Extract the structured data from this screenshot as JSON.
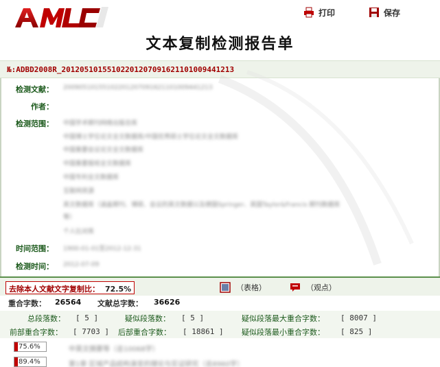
{
  "toolbar": {
    "print_label": "打印",
    "save_label": "保存"
  },
  "logo_text": "AMLC",
  "report_title": "文本复制检测报告单",
  "report_id": "№:ADBD2008R_2012051015510220120709162110100944​1213",
  "fields": {
    "document_label": "检测文献：",
    "document_value": "20090510155102201207091621101009441213",
    "author_label": "作者：",
    "scope_label": "检测范围：",
    "scope_lines": [
      "中国学术期刊网络出版总库",
      "中国博士学位论文全文数据库/中国优秀硕士学位论文全文数据库",
      "中国重要会议论文全文数据库",
      "中国重要报纸全文数据库",
      "中国专利全文数据库",
      "互联网资源",
      "英文数据库（涵盖期刊、博硕、会议的英文数据以及德国Springer、英国Taylor&Francis 期刊数据库",
      "等）",
      "个人比对库"
    ],
    "time_range_label": "时间范围：",
    "time_range_value": "1900-01-01至2012-12-31",
    "detect_time_label": "检测时间：",
    "detect_time_value": "2012-07-09"
  },
  "summary": {
    "ratio_label": "去除本人文献文字复制比：",
    "ratio_value": "72.5%",
    "table_mode_label": "（表格）",
    "view_mode_label": "（观点）",
    "overlap_chars_label": "重合字数：",
    "overlap_chars_value": "26564",
    "total_chars_label": "文献总字数：",
    "total_chars_value": "36626",
    "total_segments_label": "总段落数：",
    "total_segments_value": "[ 5 ]",
    "suspect_segments_label": "疑似段落数：",
    "suspect_segments_value": "[ 5 ]",
    "max_overlap_label": "疑似段落最大重合字数：",
    "max_overlap_value": "[ 8007 ]",
    "front_overlap_label": "前部重合字数：",
    "front_overlap_value": "[ 7703 ]",
    "back_overlap_label": "后部重合字数：",
    "back_overlap_value": "[ 18861 ]",
    "min_overlap_label": "疑似段落最小重合字数：",
    "min_overlap_value": "[ 825 ]"
  },
  "segments": [
    {
      "percent_label": "75.6%",
      "percent": 75.6,
      "text": "中英文摘要等（总10068字）"
    },
    {
      "percent_label": "89.4%",
      "percent": 89.4,
      "text": "第1章 区域产品结构演变的理论与实证研究（总8960字）"
    }
  ],
  "colors": {
    "accent_red": "#c00000",
    "label_green": "#1c5a1c",
    "band_green": "#eef3ea"
  }
}
